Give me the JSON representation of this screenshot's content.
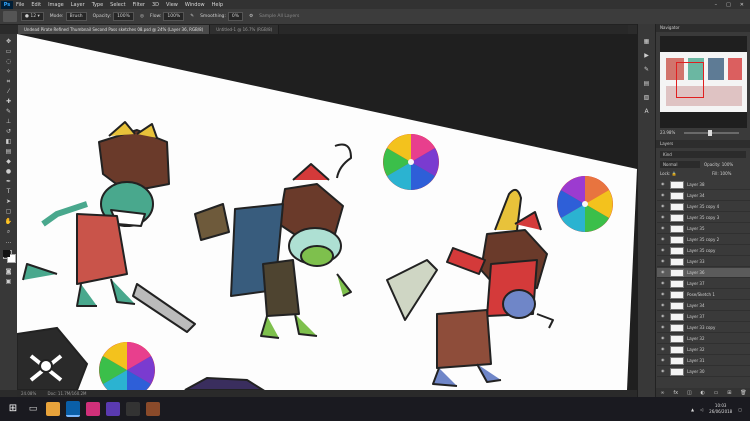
{
  "app": {
    "logo": "Ps"
  },
  "menu": [
    "File",
    "Edit",
    "Image",
    "Layer",
    "Type",
    "Select",
    "Filter",
    "3D",
    "View",
    "Window",
    "Help"
  ],
  "options": {
    "mode_label": "Mode:",
    "mode_value": "Brush",
    "opacity_label": "Opacity:",
    "opacity_value": "100%",
    "flow_label": "Flow:",
    "flow_value": "100%",
    "smoothing_label": "Smoothing:",
    "smoothing_value": "0%",
    "extra": "Sample All Layers"
  },
  "tabs": [
    {
      "label": "Undead Pirate Refined Thumbnail Second Pass sketches 08.psd @ 24% (Layer 36, RGB/8)",
      "active": true
    },
    {
      "label": "Untitled-1 @ 16.7% (RGB/8)",
      "active": false
    }
  ],
  "status": {
    "zoom": "24.08%",
    "doc": "Doc: 11.7M/160.2M"
  },
  "navigator": {
    "title": "Navigator",
    "zoom": "23.98%"
  },
  "layers": {
    "title": "Layers",
    "kind": "Kind",
    "blend": "Normal",
    "opacity_label": "Opacity:",
    "opacity_value": "100%",
    "lock_label": "Lock:",
    "fill_label": "Fill:",
    "fill_value": "100%",
    "items": [
      {
        "name": "Layer 38",
        "selected": false
      },
      {
        "name": "Layer 34",
        "selected": false
      },
      {
        "name": "Layer 35 copy 4",
        "selected": false
      },
      {
        "name": "Layer 35 copy 3",
        "selected": false
      },
      {
        "name": "Layer 35",
        "selected": false
      },
      {
        "name": "Layer 35 copy 2",
        "selected": false
      },
      {
        "name": "Layer 35 copy",
        "selected": false
      },
      {
        "name": "Layer 33",
        "selected": false
      },
      {
        "name": "Layer 36",
        "selected": true
      },
      {
        "name": "Layer 37",
        "selected": false
      },
      {
        "name": "Pose/Sketch 1",
        "selected": false
      },
      {
        "name": "Layer 34",
        "selected": false
      },
      {
        "name": "Layer 37",
        "selected": false
      },
      {
        "name": "Layer 33 copy",
        "selected": false
      },
      {
        "name": "Layer 32",
        "selected": false
      },
      {
        "name": "Layer 32",
        "selected": false
      },
      {
        "name": "Layer 31",
        "selected": false
      },
      {
        "name": "Layer 30",
        "selected": false
      }
    ]
  },
  "clock": {
    "time": "10:03",
    "date": "26/06/2018"
  },
  "colors": {
    "fg": "#111111",
    "bg": "#ffffff"
  }
}
